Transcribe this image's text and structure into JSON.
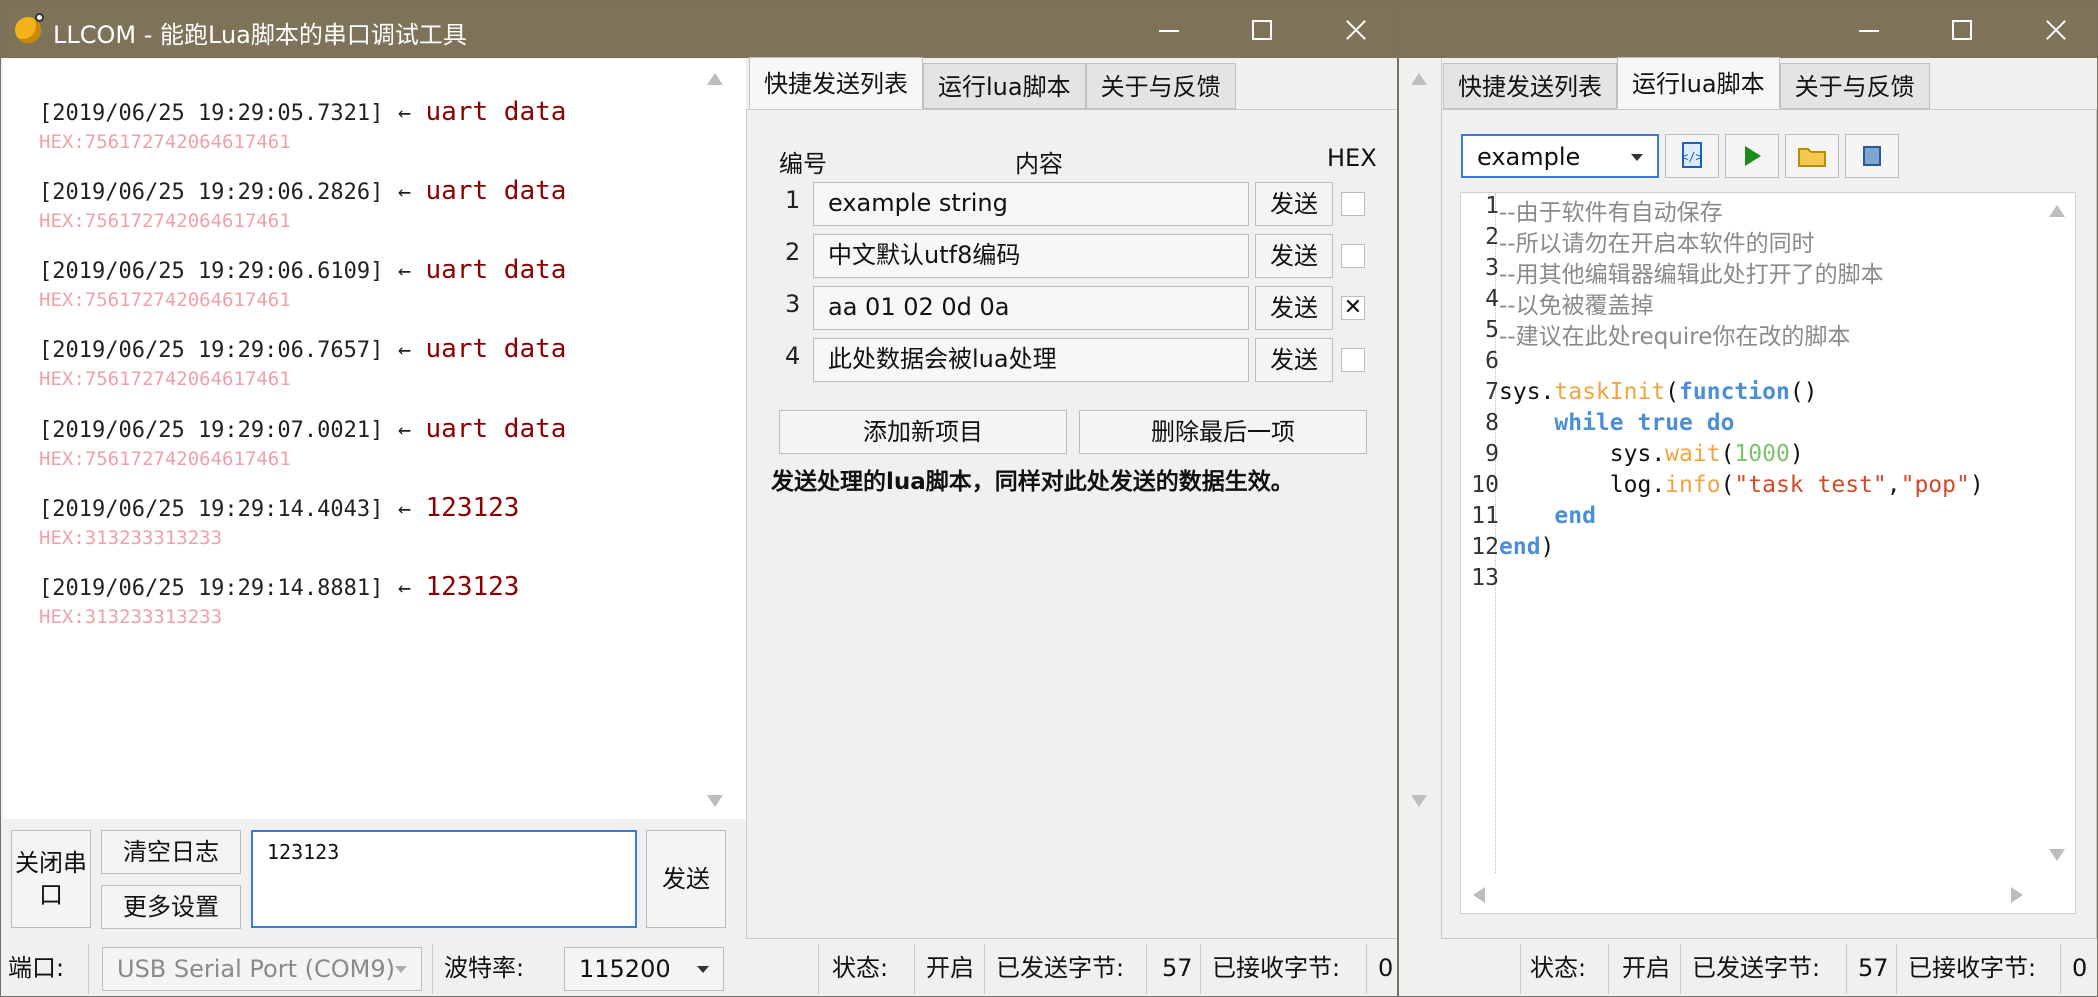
{
  "window_main": {
    "title": "LLCOM - 能跑Lua脚本的串口调试工具",
    "log": [
      {
        "ts": "[2019/06/25 19:29:05.7321]",
        "arrow": "←",
        "msg": "uart data",
        "hex": "HEX:756172742064617461"
      },
      {
        "ts": "[2019/06/25 19:29:06.2826]",
        "arrow": "←",
        "msg": "uart data",
        "hex": "HEX:756172742064617461"
      },
      {
        "ts": "[2019/06/25 19:29:06.6109]",
        "arrow": "←",
        "msg": "uart data",
        "hex": "HEX:756172742064617461"
      },
      {
        "ts": "[2019/06/25 19:29:06.7657]",
        "arrow": "←",
        "msg": "uart data",
        "hex": "HEX:756172742064617461"
      },
      {
        "ts": "[2019/06/25 19:29:07.0021]",
        "arrow": "←",
        "msg": "uart data",
        "hex": "HEX:756172742064617461"
      },
      {
        "ts": "[2019/06/25 19:29:14.4043]",
        "arrow": "←",
        "msg": "123123",
        "hex": "HEX:313233313233"
      },
      {
        "ts": "[2019/06/25 19:29:14.8881]",
        "arrow": "←",
        "msg": "123123",
        "hex": "HEX:313233313233"
      }
    ],
    "buttons": {
      "close_port": "关闭串口",
      "clear_log": "清空日志",
      "more_settings": "更多设置",
      "send": "发送"
    },
    "input_value": "123123",
    "tabs": [
      "快捷发送列表",
      "运行lua脚本",
      "关于与反馈"
    ],
    "quick_send": {
      "header_num": "编号",
      "header_content": "内容",
      "header_hex": "HEX",
      "rows": [
        {
          "num": "1",
          "content": "example string",
          "send": "发送",
          "hex": ""
        },
        {
          "num": "2",
          "content": "中文默认utf8编码",
          "send": "发送",
          "hex": ""
        },
        {
          "num": "3",
          "content": "aa 01 02 0d 0a",
          "send": "发送",
          "hex": "✕"
        },
        {
          "num": "4",
          "content": "此处数据会被lua处理",
          "send": "发送",
          "hex": ""
        }
      ],
      "add_item": "添加新项目",
      "delete_last": "删除最后一项",
      "note": "发送处理的lua脚本，同样对此处发送的数据生效。"
    }
  },
  "statusbar": {
    "port_label": "端口:",
    "port_value": "USB Serial Port (COM9)",
    "baud_label": "波特率:",
    "baud_value": "115200",
    "state_label": "状态:",
    "state_value": "开启",
    "sent_label": "已发送字节:",
    "sent_value": "57",
    "recv_label": "已接收字节:",
    "recv_value": "0"
  },
  "window_script": {
    "tabs": [
      "快捷发送列表",
      "运行lua脚本",
      "关于与反馈"
    ],
    "script_select": "example",
    "tool_icons": [
      "code-file-icon",
      "run-icon",
      "open-folder-icon",
      "book-icon"
    ],
    "code_lines": [
      {
        "n": "1",
        "text": "--由于软件有自动保存"
      },
      {
        "n": "2",
        "text": "--所以请勿在开启本软件的同时"
      },
      {
        "n": "3",
        "text": "--用其他编辑器编辑此处打开了的脚本"
      },
      {
        "n": "4",
        "text": "--以免被覆盖掉"
      },
      {
        "n": "5",
        "text": "--建议在此处require你在改的脚本"
      },
      {
        "n": "6",
        "text": ""
      },
      {
        "n": "7",
        "text": "sys.taskInit(function()"
      },
      {
        "n": "8",
        "text": "    while true do"
      },
      {
        "n": "9",
        "text": "        sys.wait(1000)"
      },
      {
        "n": "10",
        "text": "        log.info(\"task test\",\"pop\")"
      },
      {
        "n": "11",
        "text": "    end"
      },
      {
        "n": "12",
        "text": "end)"
      },
      {
        "n": "13",
        "text": ""
      }
    ]
  },
  "colors": {
    "titlebar": "#7e7359",
    "log_message": "#8b0000",
    "log_hex": "#f0a0a8",
    "keyword": "#4d8fd6",
    "function": "#f0a540",
    "string": "#d14a2a",
    "number": "#7bc26a",
    "comment": "#8a8a8a"
  }
}
